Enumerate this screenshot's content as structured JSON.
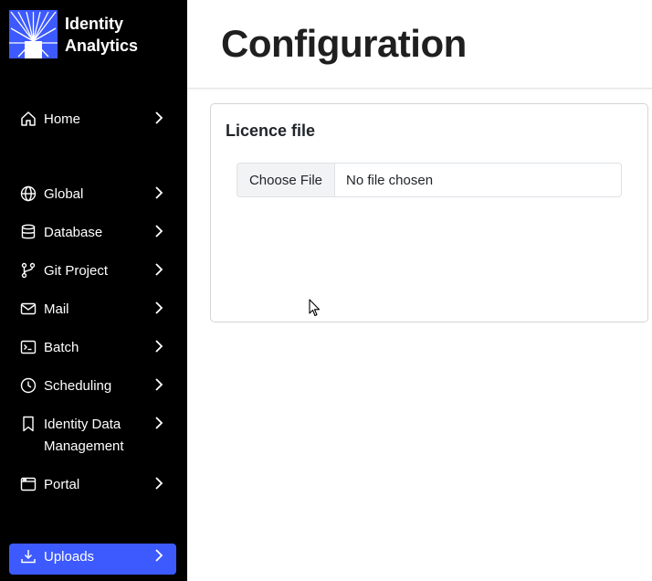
{
  "brand": {
    "line1": "Identity",
    "line2": "Analytics"
  },
  "sidebar": {
    "items": [
      {
        "label": "Home",
        "icon": "home-icon"
      },
      {
        "label": "Global",
        "icon": "globe-icon"
      },
      {
        "label": "Database",
        "icon": "database-icon"
      },
      {
        "label": "Git Project",
        "icon": "git-branch-icon"
      },
      {
        "label": "Mail",
        "icon": "mail-icon"
      },
      {
        "label": "Batch",
        "icon": "terminal-icon"
      },
      {
        "label": "Scheduling",
        "icon": "clock-icon"
      },
      {
        "label": "Identity Data Management",
        "icon": "bookmark-icon"
      },
      {
        "label": "Portal",
        "icon": "window-icon"
      },
      {
        "label": "Uploads",
        "icon": "download-icon",
        "active": true
      }
    ]
  },
  "header": {
    "title": "Configuration"
  },
  "card": {
    "title": "Licence file",
    "file_input": {
      "button_label": "Choose File",
      "status": "No file chosen"
    }
  },
  "colors": {
    "sidebar_bg": "#000000",
    "accent": "#3d5afe",
    "text_dark": "#212529"
  }
}
